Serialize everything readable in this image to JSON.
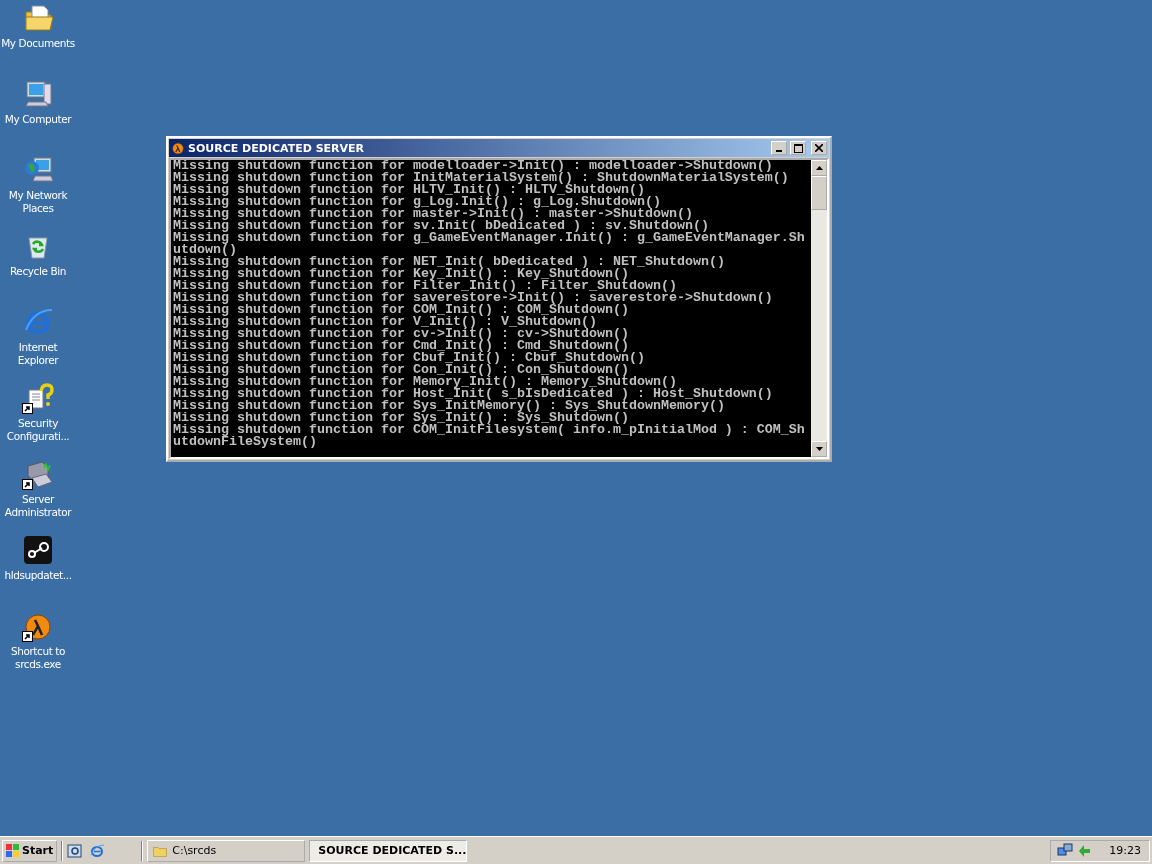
{
  "desktop_icons": [
    {
      "label": "My Documents",
      "kind": "documents",
      "shortcut": false
    },
    {
      "label": "My Computer",
      "kind": "computer",
      "shortcut": false
    },
    {
      "label": "My Network Places",
      "kind": "network",
      "shortcut": false
    },
    {
      "label": "Recycle Bin",
      "kind": "recycle",
      "shortcut": false
    },
    {
      "label": "Internet Explorer",
      "kind": "browser",
      "shortcut": false
    },
    {
      "label": "Security Configurati...",
      "kind": "security",
      "shortcut": true
    },
    {
      "label": "Server Administrator",
      "kind": "server",
      "shortcut": true
    },
    {
      "label": "hldsupdatet...",
      "kind": "steam",
      "shortcut": false
    },
    {
      "label": "Shortcut to srcds.exe",
      "kind": "lambda",
      "shortcut": true
    }
  ],
  "window": {
    "title": "SOURCE DEDICATED SERVER",
    "console_lines": [
      "Missing shutdown function for modelloader->Init() : modelloader->Shutdown()",
      "Missing shutdown function for InitMaterialSystem() : ShutdownMaterialSystem()",
      "Missing shutdown function for HLTV_Init() : HLTV_Shutdown()",
      "Missing shutdown function for g_Log.Init() : g_Log.Shutdown()",
      "Missing shutdown function for master->Init() : master->Shutdown()",
      "Missing shutdown function for sv.Init( bDedicated ) : sv.Shutdown()",
      "Missing shutdown function for g_GameEventManager.Init() : g_GameEventManager.Shutdown()",
      "Missing shutdown function for NET_Init( bDedicated ) : NET_Shutdown()",
      "Missing shutdown function for Key_Init() : Key_Shutdown()",
      "Missing shutdown function for Filter_Init() : Filter_Shutdown()",
      "Missing shutdown function for saverestore->Init() : saverestore->Shutdown()",
      "Missing shutdown function for COM_Init() : COM_Shutdown()",
      "Missing shutdown function for V_Init() : V_Shutdown()",
      "Missing shutdown function for cv->Init() : cv->Shutdown()",
      "Missing shutdown function for Cmd_Init() : Cmd_Shutdown()",
      "Missing shutdown function for Cbuf_Init() : Cbuf_Shutdown()",
      "Missing shutdown function for Con_Init() : Con_Shutdown()",
      "Missing shutdown function for Memory_Init() : Memory_Shutdown()",
      "Missing shutdown function for Host_Init( s_bIsDedicated ) : Host_Shutdown()",
      "Missing shutdown function for Sys_InitMemory() : Sys_ShutdownMemory()",
      "Missing shutdown function for Sys_Init() : Sys_Shutdown()",
      "Missing shutdown function for COM_InitFilesystem( info.m_pInitialMod ) : COM_ShutdownFileSystem()"
    ]
  },
  "taskbar": {
    "start_label": "Start",
    "tasks": [
      {
        "label": "C:\\srcds",
        "kind": "folder",
        "selected": false
      },
      {
        "label": "SOURCE DEDICATED S...",
        "kind": "lambda",
        "selected": true
      }
    ],
    "clock": "19:23"
  }
}
